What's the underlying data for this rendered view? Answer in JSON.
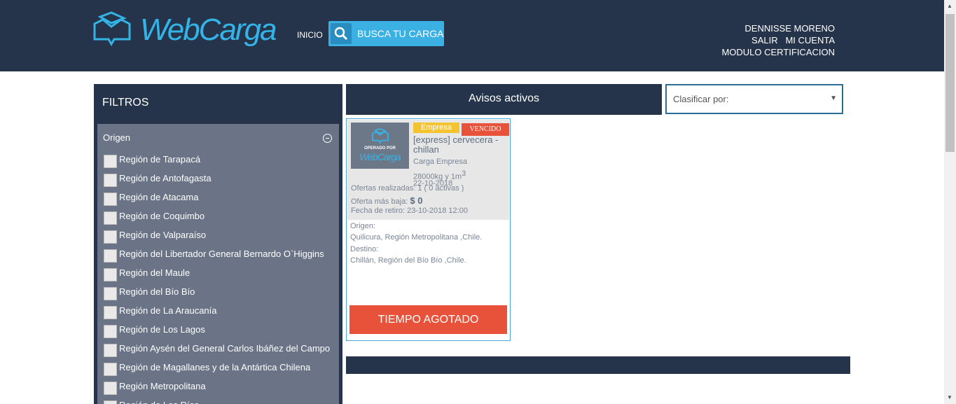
{
  "header": {
    "brand": "WebCarga",
    "nav_inicio": "INICIO",
    "search_button": "BUSCA TU CARGA",
    "user_name": "DENNISSE MORENO",
    "logout": "SALIR",
    "account": "MI CUENTA",
    "certification": "MODULO CERTIFICACION"
  },
  "sidebar": {
    "title": "FILTROS",
    "origin_label": "Origen",
    "regions": [
      "Región de Tarapacá",
      "Región de Antofagasta",
      "Región de Atacama",
      "Región de Coquimbo",
      "Región de Valparaíso",
      "Región del Libertador General Bernardo O`Higgins",
      "Región del Maule",
      "Región del Bío Bío",
      "Región de La Araucanía",
      "Región de Los Lagos",
      "Región Aysén del General Carlos Ibáñez del Campo",
      "Región de Magallanes y de la Antártica Chilena",
      "Región Metropolitana",
      "Región de Los Ríos"
    ]
  },
  "main": {
    "avisos_title": "Avisos activos",
    "sort_label": "Clasificar por:",
    "card": {
      "thumb_operated": "OPERADO POR",
      "thumb_brand": "WebCarga",
      "badge_type": "Empresa",
      "badge_status": "VENCIDO",
      "title": "[express] cervecera - chillan",
      "cargo_type": "Carga Empresa",
      "weight": "28000kg y 1m",
      "weight_sup": "3",
      "date": "22-10-2018",
      "offers": "Ofertas realizadas: 1 ( 0 activas )",
      "lowest_label": "Oferta más baja:",
      "lowest_value": "$ 0",
      "pickup": "Fecha de retiro: 23-10-2018 12:00",
      "origin_label": "Origen:",
      "origin_value": "Quilicura, Región Metropolitana ,Chile.",
      "dest_label": "Destino:",
      "dest_value": "Chillán, Región del Bío Bío ,Chile.",
      "action": "TIEMPO AGOTADO"
    }
  },
  "colors": {
    "navy": "#25344a",
    "accent_blue": "#3bb0e3",
    "filter_gray": "#6a7486",
    "alert_red": "#e8523a",
    "badge_yellow": "#f4c430"
  }
}
